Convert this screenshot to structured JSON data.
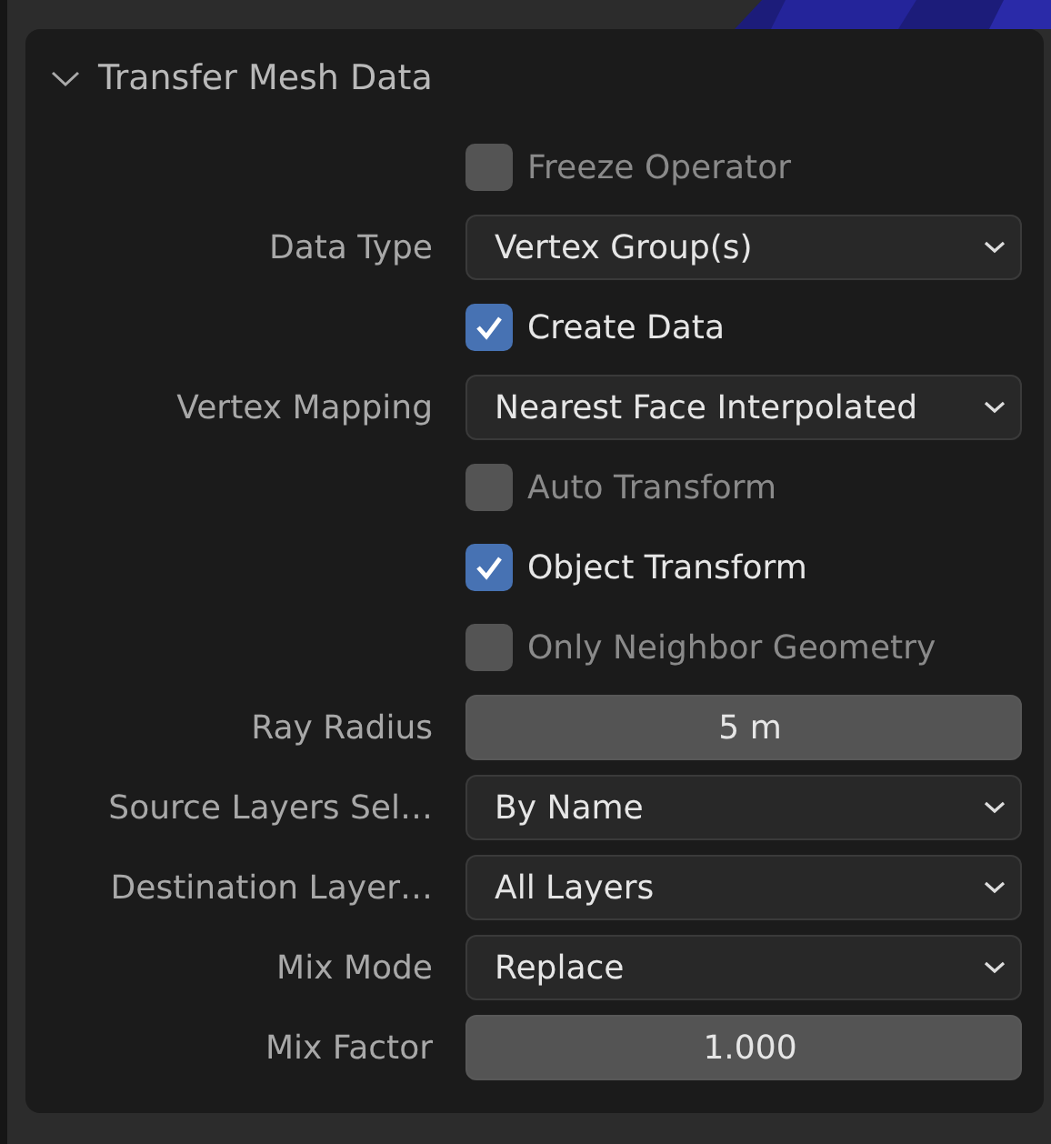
{
  "panel": {
    "title": "Transfer Mesh Data",
    "expanded": true
  },
  "rows": [
    {
      "kind": "checkbox",
      "label": "Freeze Operator",
      "checked": false,
      "disabled": true
    },
    {
      "kind": "dropdown",
      "label": "Data Type",
      "value": "Vertex Group(s)"
    },
    {
      "kind": "checkbox",
      "label": "Create Data",
      "checked": true,
      "disabled": false
    },
    {
      "kind": "dropdown",
      "label": "Vertex Mapping",
      "value": "Nearest Face Interpolated"
    },
    {
      "kind": "checkbox",
      "label": "Auto Transform",
      "checked": false,
      "disabled": true
    },
    {
      "kind": "checkbox",
      "label": "Object Transform",
      "checked": true,
      "disabled": false
    },
    {
      "kind": "checkbox",
      "label": "Only Neighbor Geometry",
      "checked": false,
      "disabled": true
    },
    {
      "kind": "number",
      "label": "Ray Radius",
      "value": "5 m"
    },
    {
      "kind": "dropdown",
      "label": "Source Layers Sel…",
      "value": "By Name"
    },
    {
      "kind": "dropdown",
      "label": "Destination Layer…",
      "value": "All Layers"
    },
    {
      "kind": "dropdown",
      "label": "Mix Mode",
      "value": "Replace"
    },
    {
      "kind": "number",
      "label": "Mix Factor",
      "value": "1.000"
    }
  ]
}
